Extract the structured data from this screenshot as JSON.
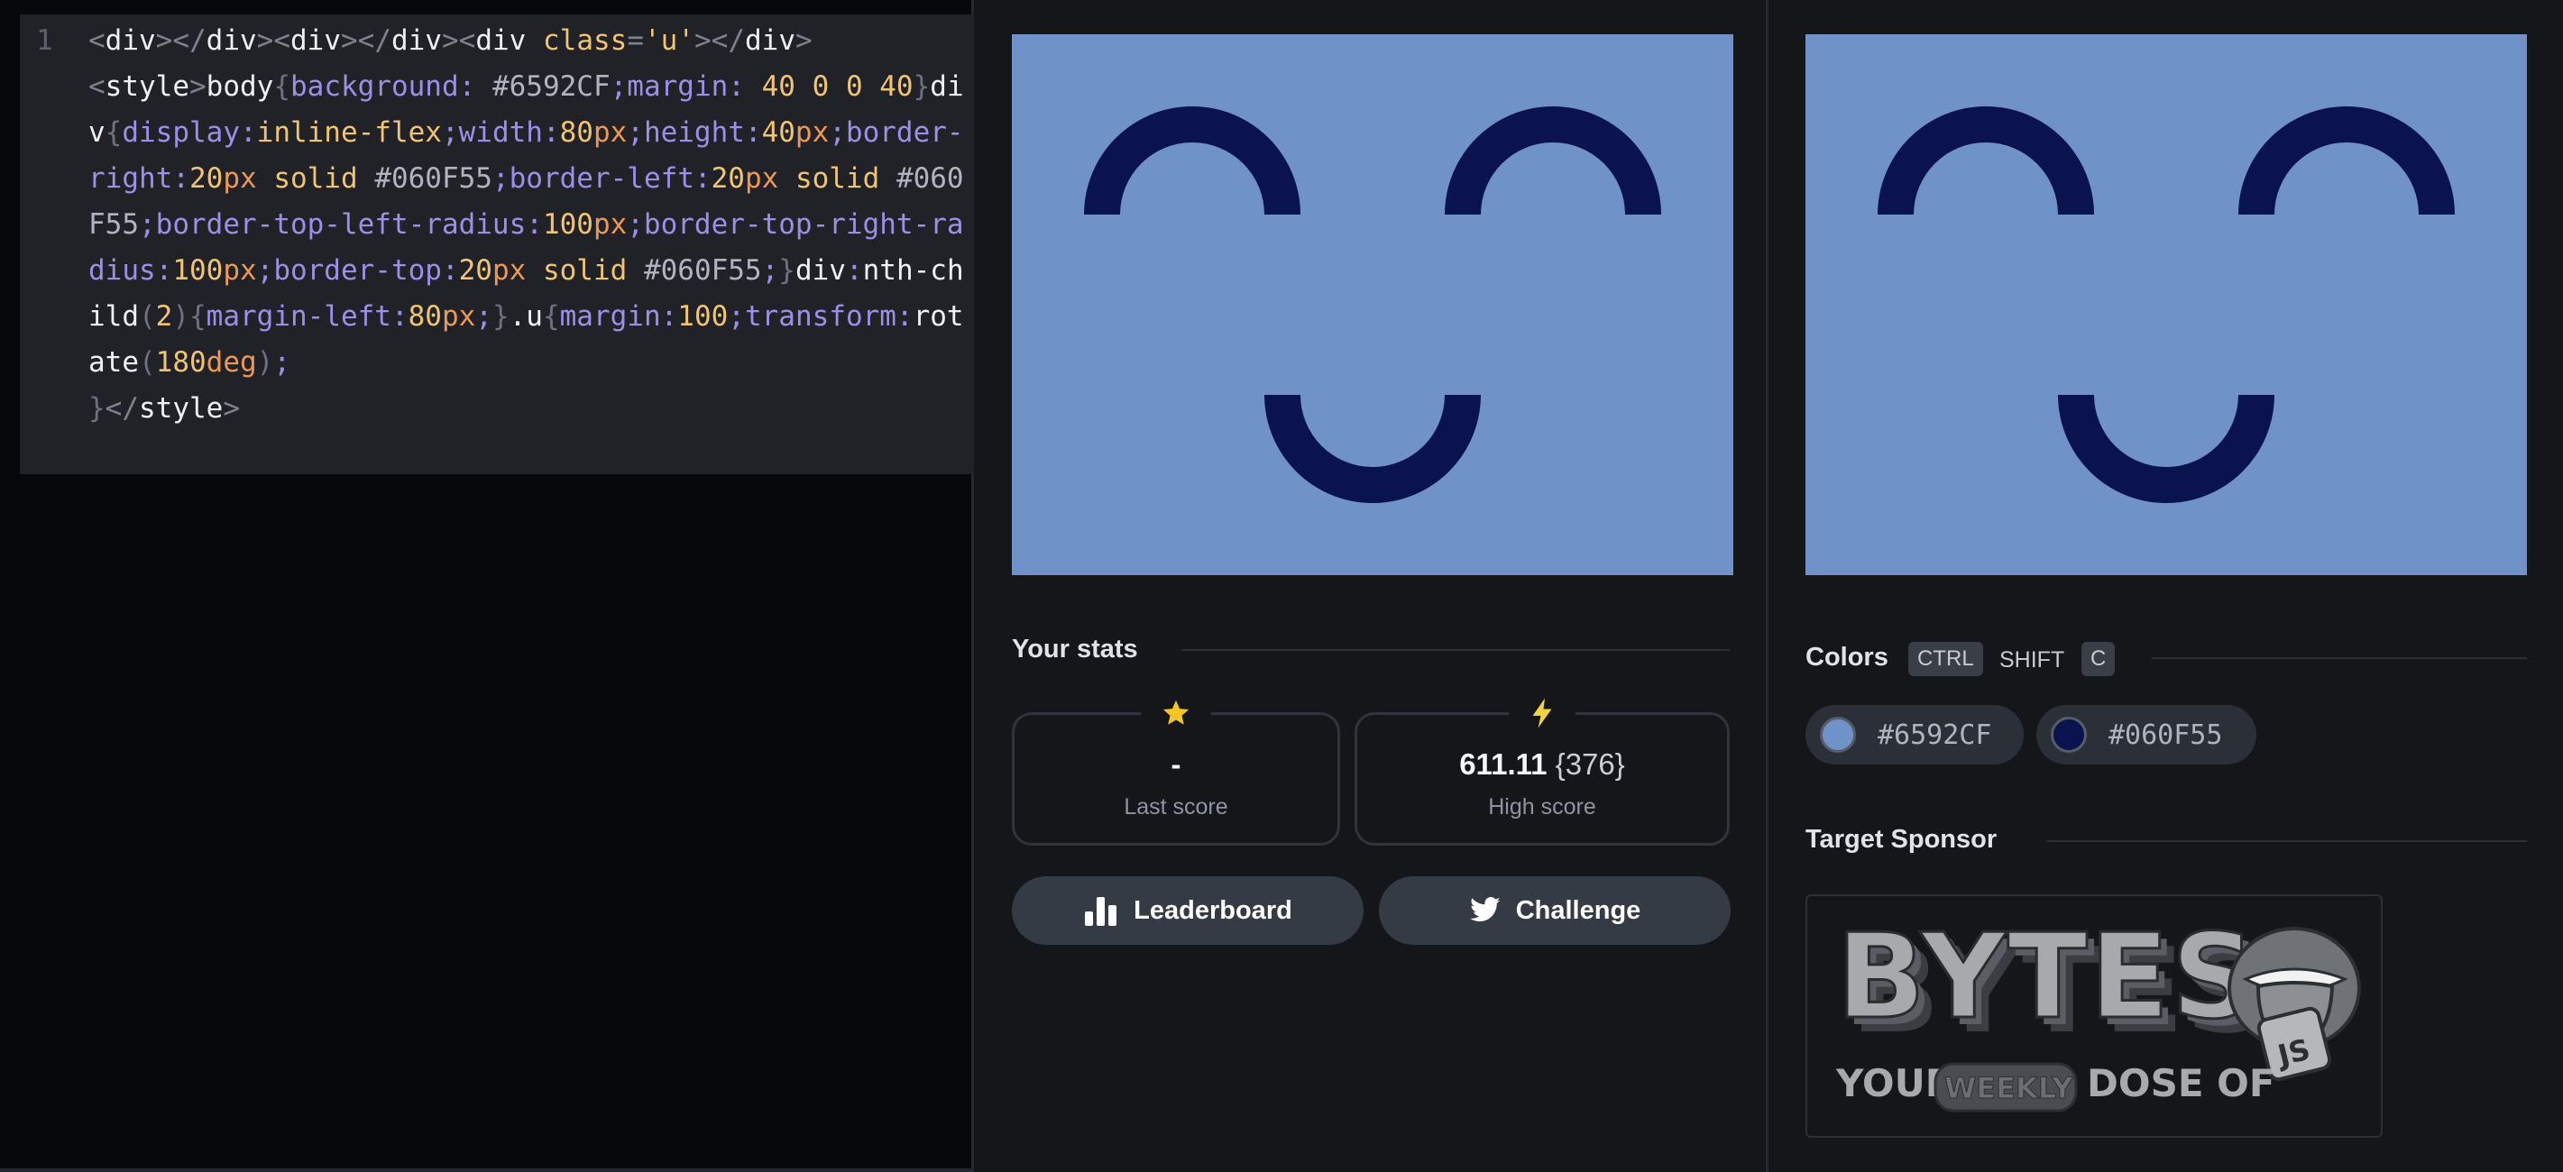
{
  "editor": {
    "line_number": "1"
  },
  "preview": {
    "background": "#6f93c9",
    "shape_color": "#0b134f"
  },
  "stats": {
    "title": "Your stats",
    "last_score": {
      "value": "-",
      "label": "Last score",
      "icon": "star-icon"
    },
    "high_score": {
      "value": "611.11",
      "extra": "{376}",
      "label": "High score",
      "icon": "lightning-icon"
    }
  },
  "buttons": {
    "leaderboard": "Leaderboard",
    "challenge": "Challenge"
  },
  "colors": {
    "title": "Colors",
    "shortcut": {
      "key1": "CTRL",
      "key2": "SHIFT",
      "key3": "C"
    },
    "swatches": [
      {
        "hex": "#6592CF",
        "label": "#6592CF"
      },
      {
        "hex": "#060F55",
        "label": "#060F55"
      }
    ]
  },
  "sponsor": {
    "title": "Target Sponsor",
    "logo_word": "BYTES",
    "tagline_1": "YOUR",
    "tagline_2": "WEEKLY",
    "tagline_3": "DOSE OF",
    "badge": "JS"
  }
}
